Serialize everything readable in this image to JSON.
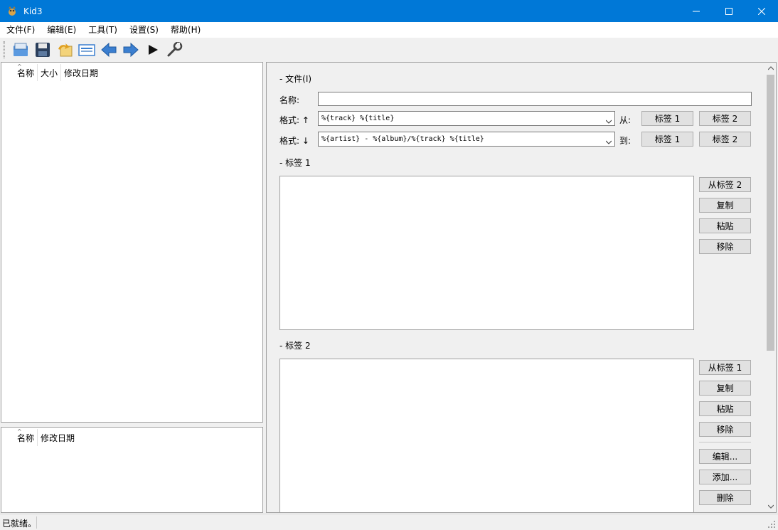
{
  "window": {
    "title": "Kid3"
  },
  "menu": [
    "文件(F)",
    "编辑(E)",
    "工具(T)",
    "设置(S)",
    "帮助(H)"
  ],
  "toolbar": [
    "open-folder-icon",
    "save-icon",
    "revert-icon",
    "filelist-icon",
    "previous-icon",
    "next-icon",
    "play-icon",
    "settings-wrench-icon"
  ],
  "file_list": {
    "columns": [
      "名称",
      "大小",
      "修改日期"
    ]
  },
  "dir_list": {
    "columns": [
      "名称",
      "修改日期"
    ]
  },
  "file_section": {
    "title": "-  文件(I)",
    "name_label": "名称:",
    "name_value": "",
    "format_up_label": "格式: ↑",
    "format_up_value": "%{track} %{title}",
    "from_label": "从:",
    "format_down_label": "格式: ↓",
    "format_down_value": "%{artist} - %{album}/%{track} %{title}",
    "to_label": "到:",
    "tag1_btn": "标签 1",
    "tag2_btn": "标签 2"
  },
  "tag1_section": {
    "title": "-  标签 1",
    "buttons": {
      "from_tag": "从标签 2",
      "copy": "复制",
      "paste": "粘贴",
      "remove": "移除"
    }
  },
  "tag2_section": {
    "title": "-  标签 2",
    "buttons": {
      "from_tag": "从标签 1",
      "copy": "复制",
      "paste": "粘贴",
      "remove": "移除",
      "edit": "编辑...",
      "add": "添加...",
      "delete": "删除"
    }
  },
  "status": {
    "text": "已就绪。"
  },
  "colors": {
    "titlebar": "#0078d7",
    "toolbar_blue": "#3b7fd0"
  }
}
